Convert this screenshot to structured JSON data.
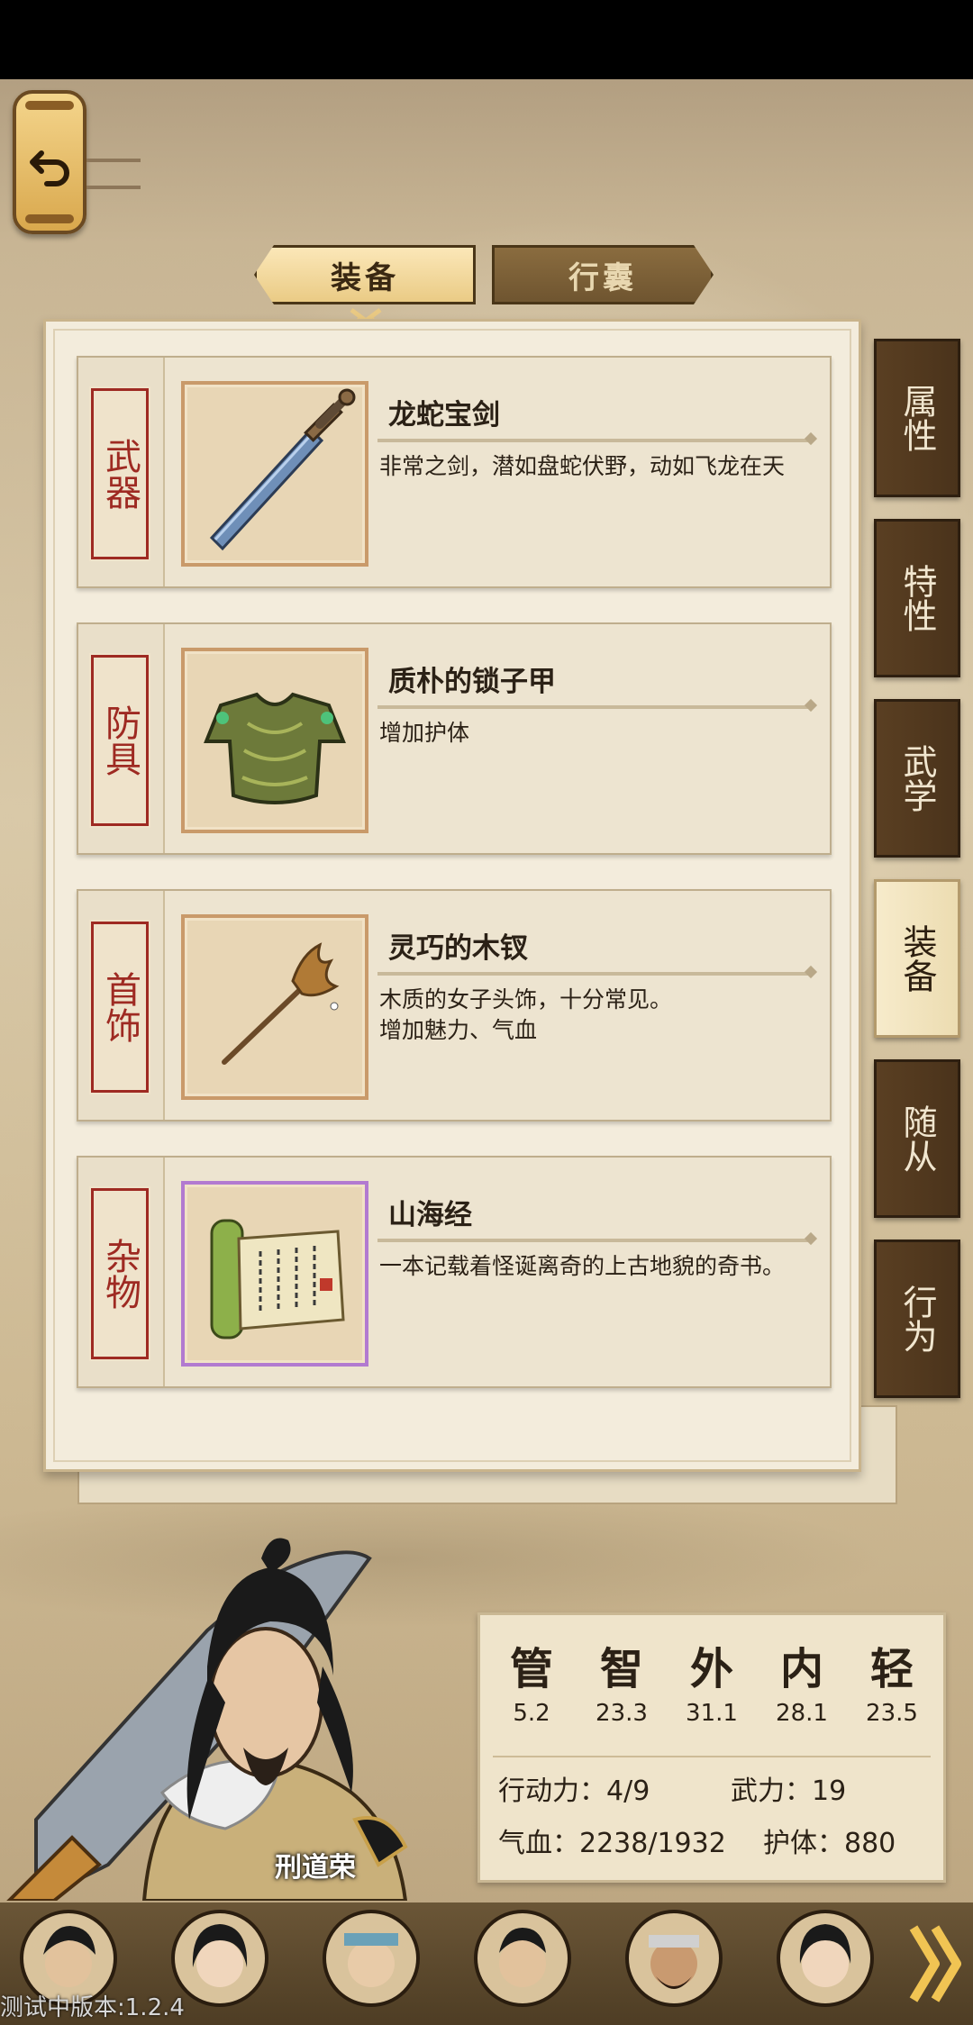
{
  "nav": {
    "back_label": "Back"
  },
  "top_tabs": [
    {
      "label": "装备",
      "active": true
    },
    {
      "label": "行囊",
      "active": false
    }
  ],
  "equipment": [
    {
      "category": "武器",
      "name": "龙蛇宝剑",
      "description": "非常之剑，潜如盘蛇伏野，动如飞龙在天",
      "icon": "sword-icon"
    },
    {
      "category": "防具",
      "name": "质朴的锁子甲",
      "description": "增加护体",
      "icon": "chainmail-armor-icon"
    },
    {
      "category": "首饰",
      "name": "灵巧的木钗",
      "description": "木质的女子头饰，十分常见。\n增加魅力、气血",
      "icon": "wooden-hairpin-icon"
    },
    {
      "category": "杂物",
      "name": "山海经",
      "description": "一本记载着怪诞离奇的上古地貌的奇书。",
      "icon": "scroll-icon"
    }
  ],
  "side_tabs": [
    {
      "label": "属性",
      "active": false
    },
    {
      "label": "特性",
      "active": false
    },
    {
      "label": "武学",
      "active": false
    },
    {
      "label": "装备",
      "active": true
    },
    {
      "label": "随从",
      "active": false
    },
    {
      "label": "行为",
      "active": false
    }
  ],
  "character": {
    "name": "刑道荣"
  },
  "stats": {
    "attributes": [
      {
        "label": "管",
        "value": "5.2"
      },
      {
        "label": "智",
        "value": "23.3"
      },
      {
        "label": "外",
        "value": "31.1"
      },
      {
        "label": "内",
        "value": "28.1"
      },
      {
        "label": "轻",
        "value": "23.5"
      }
    ],
    "action_points": "行动力：4/9",
    "force": "武力：19",
    "hp": "气血：2238/1932",
    "defense": "护体：880"
  },
  "roster": [
    "avatar-1",
    "avatar-2",
    "avatar-3",
    "avatar-4",
    "avatar-5",
    "avatar-6"
  ],
  "footer": {
    "version": "测试中版本:1.2.4"
  },
  "colors": {
    "accent_red": "#9e2a22",
    "tab_dark": "#4a331b",
    "tab_active": "#f7ebcb"
  }
}
